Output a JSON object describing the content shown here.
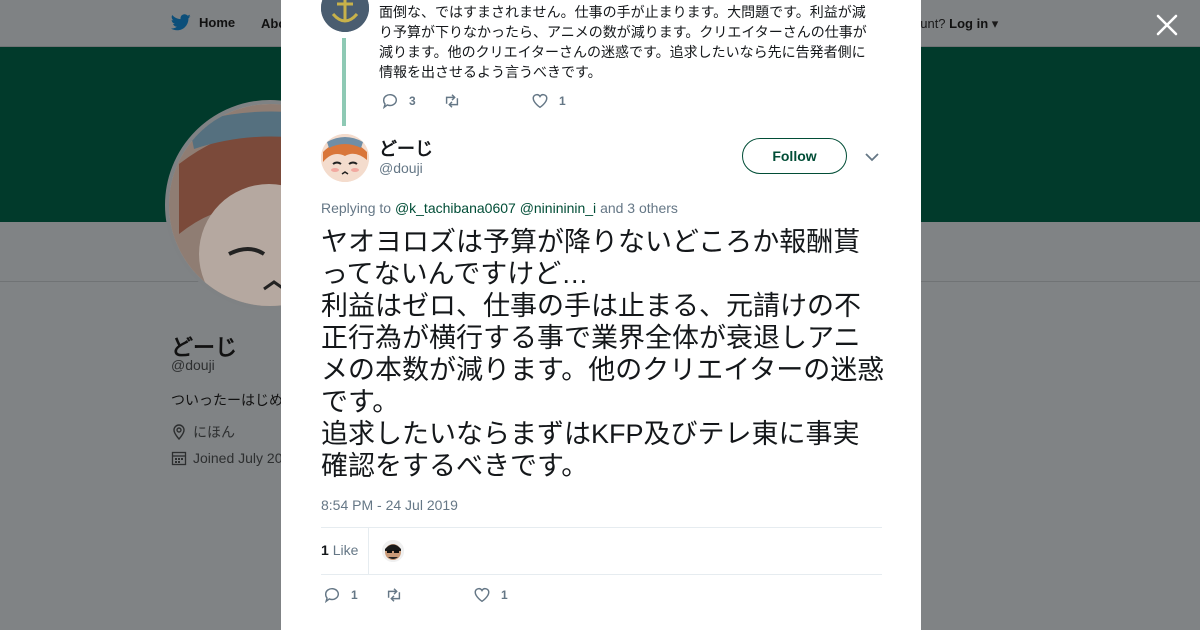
{
  "nav": {
    "home_label": "Home",
    "about_label": "Abo",
    "account_prompt": "ccount?",
    "login_label": "Log in"
  },
  "profile": {
    "name": "どーじ",
    "handle": "@douji",
    "bio": "ついったーはじめ",
    "location": "にほん",
    "joined": "Joined July 20"
  },
  "parent_tweet": {
    "text": "面倒な、ではすまされません。仕事の手が止まります。大問題です。利益が減り予算が下りなかったら、アニメの数が減ります。クリエイターさんの仕事が減ります。他のクリエイターさんの迷惑です。追求したいなら先に告発者側に情報を出させるよう言うべきです。",
    "reply_count": "3",
    "retweet_count": "",
    "like_count": "1"
  },
  "tweet": {
    "author_name": "どーじ",
    "author_handle": "@douji",
    "follow_label": "Follow",
    "replying_prefix": "Replying to",
    "reply_user_1": "@k_tachibana0607",
    "reply_user_2": "@ninininin_i",
    "reply_suffix": "and 3 others",
    "text": "ヤオヨロズは予算が降りないどころか報酬貰ってないんですけど…\n利益はゼロ、仕事の手は止まる、元請けの不正行為が横行する事で業界全体が衰退しアニメの本数が減ります。他のクリエイターの迷惑です。\n追求したいならまずはKFP及びテレ東に事実確認をするべきです。",
    "timestamp": "8:54 PM - 24 Jul 2019",
    "likes_count": "1",
    "likes_label": "Like",
    "reply_count": "1",
    "retweet_count": "",
    "like_count": "1"
  },
  "colors": {
    "brand_green": "#014d36",
    "banner": "#013a2b",
    "thread_line": "#8ec9b4",
    "overlay": "#808385"
  }
}
